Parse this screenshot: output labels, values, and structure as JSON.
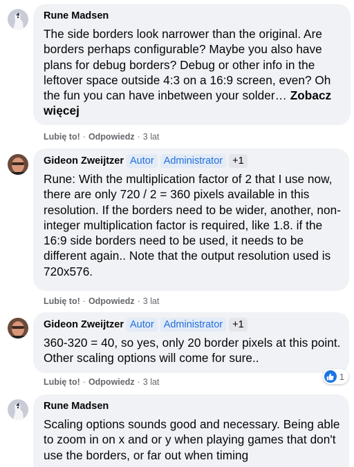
{
  "comments": [
    {
      "author": "Rune Madsen",
      "text": "The side borders look narrower than the original. Are borders perhaps configurable? Maybe you also have plans for debug borders? Debug or other info in the leftover space outside 4:3 on a 16:9 screen, even? Oh the fun you can have inbetween your solder…",
      "see_more": "Zobacz więcej",
      "like": "Lubię to!",
      "reply": "Odpowiedz",
      "time": "3 lat"
    },
    {
      "author": "Gideon Zweijtzer",
      "badges": [
        "Autor",
        "Administrator",
        "+1"
      ],
      "text": "Rune: With the multiplication factor of 2 that I use now, there are only 720 / 2 = 360 pixels available in this resolution. If the borders need to be wider, another, non-integer multiplication factor is required, like 1.8. if the 16:9 side borders need to be used, it needs to be different again.. Note that the output resolution used is 720x576.",
      "like": "Lubię to!",
      "reply": "Odpowiedz",
      "time": "3 lat"
    },
    {
      "author": "Gideon Zweijtzer",
      "badges": [
        "Autor",
        "Administrator",
        "+1"
      ],
      "text": "360-320 = 40, so yes, only 20 border pixels at this point. Other scaling options will come for sure..",
      "like": "Lubię to!",
      "reply": "Odpowiedz",
      "time": "3 lat",
      "reaction_count": "1"
    },
    {
      "author": "Rune Madsen",
      "text": "Scaling options sounds good and necessary. Being able to zoom in on x and or y when playing games that don't use the borders, or far out when timing"
    }
  ],
  "colors": {
    "bubble": "#f0f2f5",
    "badge_text": "#216fdb",
    "badge_bg": "#e3ebf7",
    "meta": "#65676b",
    "like_blue": "#1b74e4"
  },
  "icons": [
    "avatar-rune",
    "avatar-gideon",
    "like-icon"
  ]
}
